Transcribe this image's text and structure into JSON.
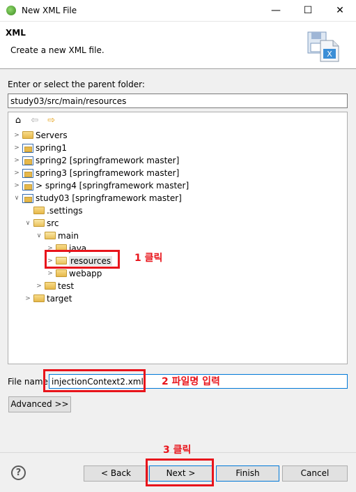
{
  "window": {
    "title": "New XML File",
    "min_glyph": "—",
    "max_glyph": "☐",
    "close_glyph": "✕"
  },
  "banner": {
    "heading": "XML",
    "description": "Create a new XML file."
  },
  "parent_folder": {
    "label": "Enter or select the parent folder:",
    "value": "study03/src/main/resources"
  },
  "tree": {
    "items": [
      {
        "label": "Servers"
      },
      {
        "label": "spring1"
      },
      {
        "label": "spring2 [springframework master]"
      },
      {
        "label": "spring3 [springframework master]"
      },
      {
        "label": "> spring4 [springframework master]"
      },
      {
        "label": "study03 [springframework master]"
      },
      {
        "label": ".settings"
      },
      {
        "label": "src"
      },
      {
        "label": "main"
      },
      {
        "label": "java"
      },
      {
        "label": "resources"
      },
      {
        "label": "webapp"
      },
      {
        "label": "test"
      },
      {
        "label": "target"
      }
    ]
  },
  "file_name": {
    "label": "File name",
    "value": "injectionContext2.xml"
  },
  "buttons": {
    "advanced": "Advanced >>",
    "back": "< Back",
    "next": "Next >",
    "finish": "Finish",
    "cancel": "Cancel",
    "help": "?"
  },
  "annotations": {
    "step1": "1 클릭",
    "step2": "2 파일명 입력",
    "step3": "3 클릭"
  },
  "colors": {
    "annotation": "#e8141b",
    "focus": "#0078d7"
  }
}
